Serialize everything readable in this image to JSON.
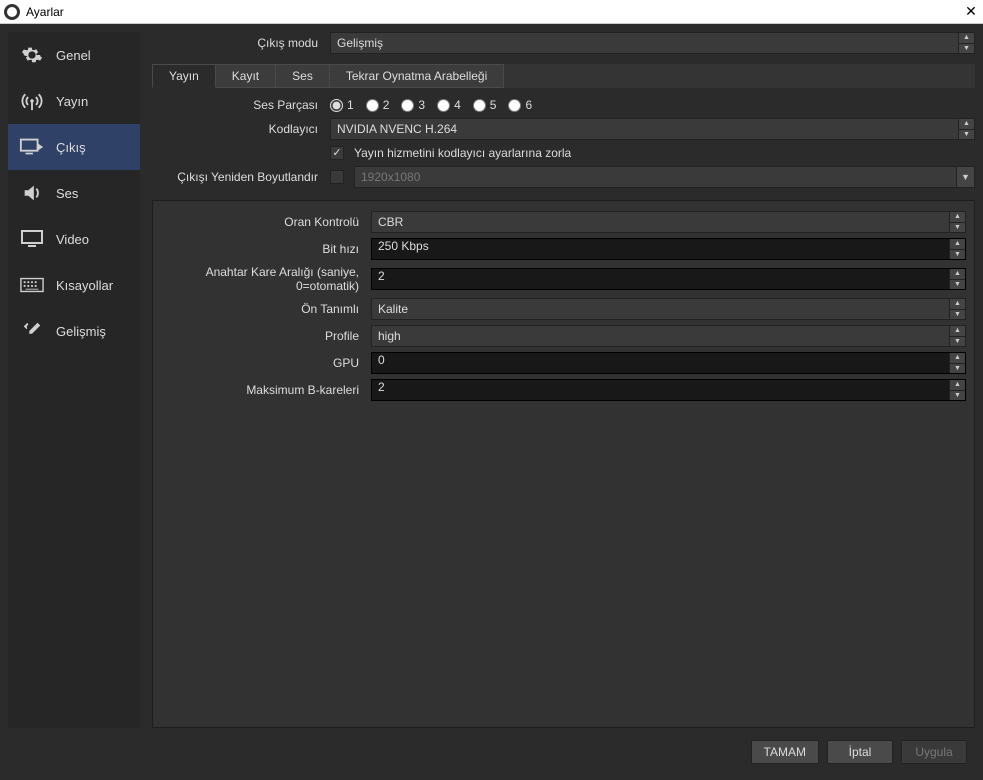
{
  "window": {
    "title": "Ayarlar"
  },
  "sidebar": {
    "items": [
      {
        "label": "Genel"
      },
      {
        "label": "Yayın"
      },
      {
        "label": "Çıkış"
      },
      {
        "label": "Ses"
      },
      {
        "label": "Video"
      },
      {
        "label": "Kısayollar"
      },
      {
        "label": "Gelişmiş"
      }
    ]
  },
  "header": {
    "output_mode_label": "Çıkış modu",
    "output_mode_value": "Gelişmiş"
  },
  "tabs": [
    {
      "label": "Yayın"
    },
    {
      "label": "Kayıt"
    },
    {
      "label": "Ses"
    },
    {
      "label": "Tekrar Oynatma Arabelleği"
    }
  ],
  "form_top": {
    "audio_track_label": "Ses Parçası",
    "audio_tracks": [
      "1",
      "2",
      "3",
      "4",
      "5",
      "6"
    ],
    "encoder_label": "Kodlayıcı",
    "encoder_value": "NVIDIA NVENC H.264",
    "enforce_label": "Yayın hizmetini kodlayıcı ayarlarına zorla",
    "rescale_label": "Çıkışı Yeniden Boyutlandır",
    "rescale_value": "1920x1080"
  },
  "panel": {
    "rate_control_label": "Oran Kontrolü",
    "rate_control_value": "CBR",
    "bitrate_label": "Bit hızı",
    "bitrate_value": "250 Kbps",
    "keyframe_label": "Anahtar Kare Aralığı (saniye, 0=otomatik)",
    "keyframe_value": "2",
    "preset_label": "Ön Tanımlı",
    "preset_value": "Kalite",
    "profile_label": "Profile",
    "profile_value": "high",
    "gpu_label": "GPU",
    "gpu_value": "0",
    "bframes_label": "Maksimum B-kareleri",
    "bframes_value": "2"
  },
  "footer": {
    "ok": "TAMAM",
    "cancel": "İptal",
    "apply": "Uygula"
  }
}
